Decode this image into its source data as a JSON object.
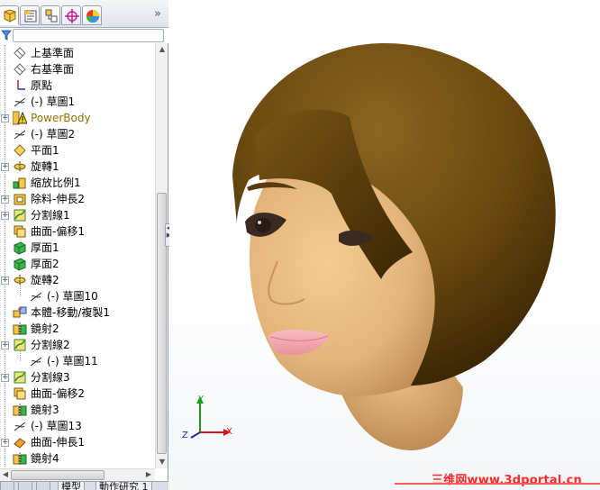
{
  "feature_tree": {
    "tabs": [
      {
        "name": "feature-manager",
        "icon": "feature-manager-icon"
      },
      {
        "name": "property-manager",
        "icon": "property-manager-icon"
      },
      {
        "name": "configuration-manager",
        "icon": "configuration-manager-icon"
      },
      {
        "name": "dim-xpert-manager",
        "icon": "dimxpert-icon"
      },
      {
        "name": "display-manager",
        "icon": "display-manager-icon"
      }
    ],
    "more_label": "»",
    "items": [
      {
        "label": "上基準面",
        "icon": "plane-icon",
        "depth": 0,
        "expander": false,
        "warn": false
      },
      {
        "label": "右基準面",
        "icon": "plane-icon",
        "depth": 0,
        "expander": false,
        "warn": false
      },
      {
        "label": "原點",
        "icon": "origin-icon",
        "depth": 0,
        "expander": false,
        "warn": false
      },
      {
        "label": "(-) 草圖1",
        "icon": "sketch-icon",
        "depth": 0,
        "expander": false,
        "warn": false
      },
      {
        "label": "PowerBody",
        "icon": "warning-icon",
        "depth": 0,
        "expander": true,
        "warn": true
      },
      {
        "label": "(-) 草圖2",
        "icon": "sketch-icon",
        "depth": 0,
        "expander": false,
        "warn": false
      },
      {
        "label": "平面1",
        "icon": "plane-feature-icon",
        "depth": 0,
        "expander": false,
        "warn": false
      },
      {
        "label": "旋轉1",
        "icon": "revolve-icon",
        "depth": 0,
        "expander": true,
        "warn": false
      },
      {
        "label": "縮放比例1",
        "icon": "scale-icon",
        "depth": 0,
        "expander": false,
        "warn": false
      },
      {
        "label": "除料-伸長2",
        "icon": "extrude-cut-icon",
        "depth": 0,
        "expander": true,
        "warn": false
      },
      {
        "label": "分割線1",
        "icon": "split-line-icon",
        "depth": 0,
        "expander": true,
        "warn": false
      },
      {
        "label": "曲面-偏移1",
        "icon": "offset-surface-icon",
        "depth": 0,
        "expander": false,
        "warn": false
      },
      {
        "label": "厚面1",
        "icon": "thicken-icon",
        "depth": 0,
        "expander": false,
        "warn": false
      },
      {
        "label": "厚面2",
        "icon": "thicken-icon",
        "depth": 0,
        "expander": false,
        "warn": false
      },
      {
        "label": "旋轉2",
        "icon": "revolve-icon",
        "depth": 0,
        "expander": true,
        "warn": false
      },
      {
        "label": "(-) 草圖10",
        "icon": "sketch-icon",
        "depth": 1,
        "expander": false,
        "warn": false
      },
      {
        "label": "本體-移動/複製1",
        "icon": "move-copy-body-icon",
        "depth": 0,
        "expander": false,
        "warn": false
      },
      {
        "label": "鏡射2",
        "icon": "mirror-icon",
        "depth": 0,
        "expander": false,
        "warn": false
      },
      {
        "label": "分割線2",
        "icon": "split-line-icon",
        "depth": 0,
        "expander": true,
        "warn": false
      },
      {
        "label": "(-) 草圖11",
        "icon": "sketch-icon",
        "depth": 1,
        "expander": false,
        "warn": false
      },
      {
        "label": "分割線3",
        "icon": "split-line-icon",
        "depth": 0,
        "expander": true,
        "warn": false
      },
      {
        "label": "曲面-偏移2",
        "icon": "offset-surface-icon",
        "depth": 0,
        "expander": false,
        "warn": false
      },
      {
        "label": "鏡射3",
        "icon": "mirror-icon",
        "depth": 0,
        "expander": false,
        "warn": false
      },
      {
        "label": "(-) 草圖13",
        "icon": "sketch-icon",
        "depth": 0,
        "expander": false,
        "warn": false
      },
      {
        "label": "曲面-伸長1",
        "icon": "extrude-surface-icon",
        "depth": 0,
        "expander": true,
        "warn": false
      },
      {
        "label": "鏡射4",
        "icon": "mirror-icon",
        "depth": 0,
        "expander": false,
        "warn": false
      }
    ]
  },
  "bottom_tabs": [
    "",
    "模型",
    "動作研究 1"
  ],
  "viewport": {
    "axis_labels": {
      "x": "X",
      "y": "Y",
      "z": "Z"
    },
    "watermark": "三维网www.3dportal.cn"
  },
  "colors": {
    "hair": "#6b4a10",
    "skin": "#e2b47a",
    "lips": "#f3a7ad",
    "watermark": "#ff2a2a",
    "axis_x": "#d01818",
    "axis_y": "#1b9d1b",
    "axis_z": "#1c2ea8"
  }
}
